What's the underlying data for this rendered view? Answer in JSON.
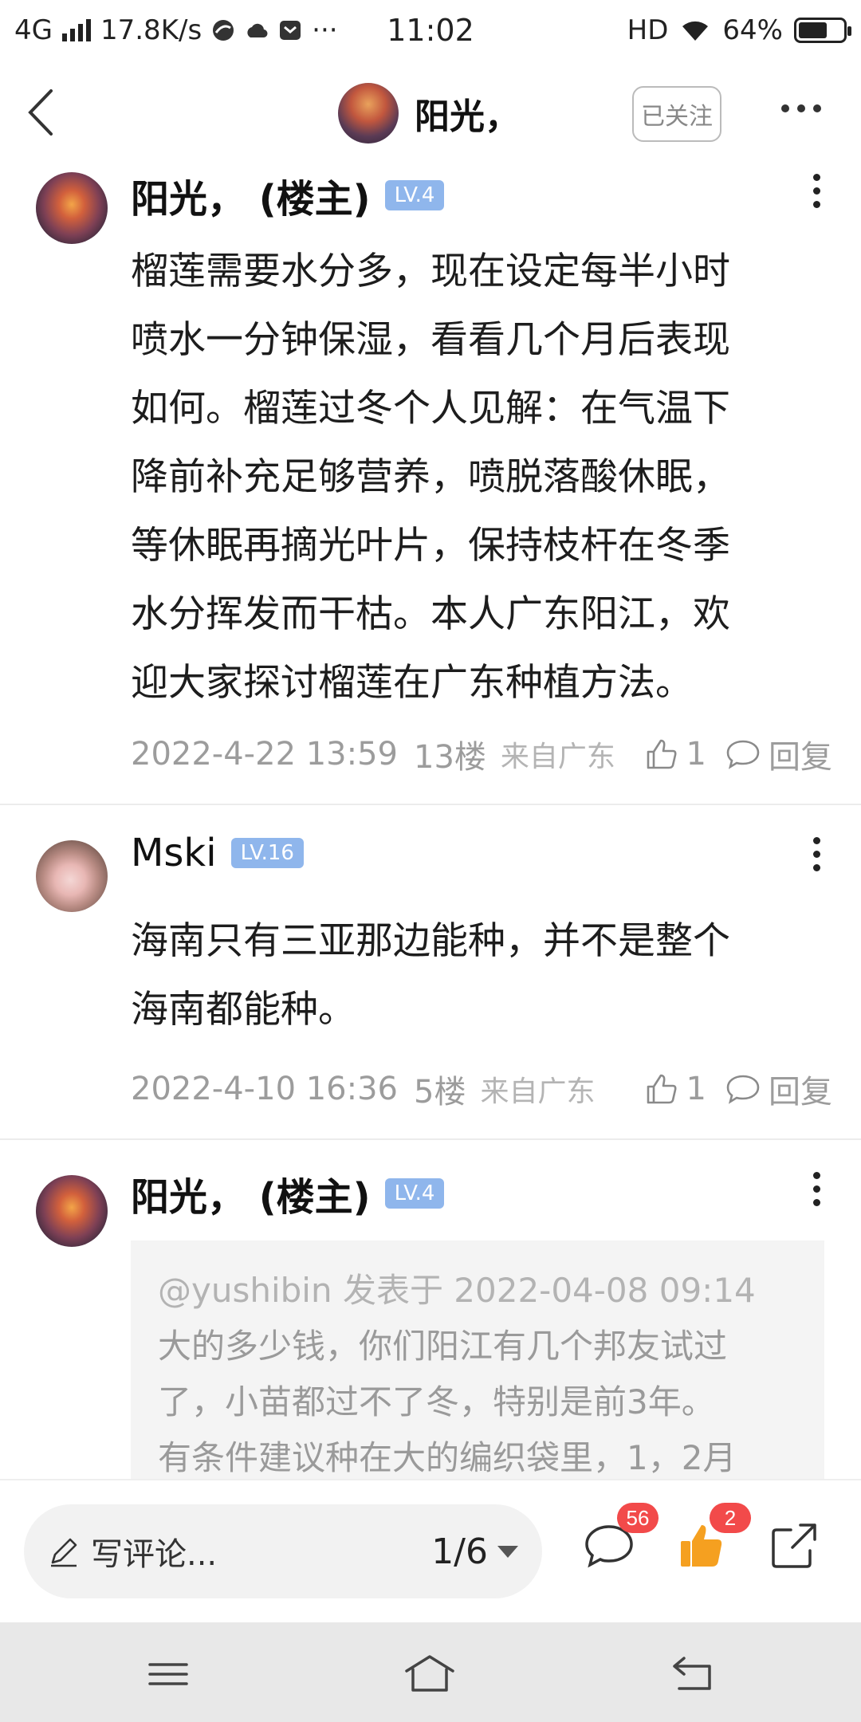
{
  "status_bar": {
    "network": "4G",
    "speed": "17.8K/s",
    "more": "···",
    "time": "11:02",
    "hd": "HD",
    "battery": "64%",
    "battery_level": 0.64
  },
  "header": {
    "title": "阳光，",
    "follow_label": "已关注"
  },
  "posts": [
    {
      "author": "阳光， (楼主)",
      "level": "LV.4",
      "lines": [
        "榴莲需要水分多，现在设定每半小时",
        "喷水一分钟保湿，看看几个月后表现",
        "如何。榴莲过冬个人见解：在气温下",
        "降前补充足够营养，喷脱落酸休眠，",
        "等休眠再摘光叶片，保持枝杆在冬季",
        "水分挥发而干枯。本人广东阳江，欢",
        "迎大家探讨榴莲在广东种植方法。"
      ],
      "date": "2022-4-22 13:59",
      "floor": "13楼",
      "from": "来自广东",
      "likes": "1",
      "reply_label": "回复"
    },
    {
      "author": "Mski",
      "level": "LV.16",
      "lines": [
        "海南只有三亚那边能种，并不是整个",
        "海南都能种。"
      ],
      "date": "2022-4-10 16:36",
      "floor": "5楼",
      "from": "来自广东",
      "likes": "1",
      "reply_label": "回复"
    },
    {
      "author": "阳光， (楼主)",
      "level": "LV.4",
      "quote_header": "@yushibin 发表于 2022-04-08 09:14",
      "quote_lines": [
        "大的多少钱，你们阳江有几个邦友试过",
        "了，小苗都过不了冬，特别是前3年。",
        "有条件建议种在大的编织袋里，1，2月"
      ]
    }
  ],
  "bottom_bar": {
    "comment_placeholder": "写评论...",
    "page_indicator": "1/6",
    "comment_count": "56",
    "like_count": "2"
  },
  "colors": {
    "level_badge": "#8fb6ec",
    "badge_red": "#f24a4a",
    "like_orange": "#f5a020"
  }
}
